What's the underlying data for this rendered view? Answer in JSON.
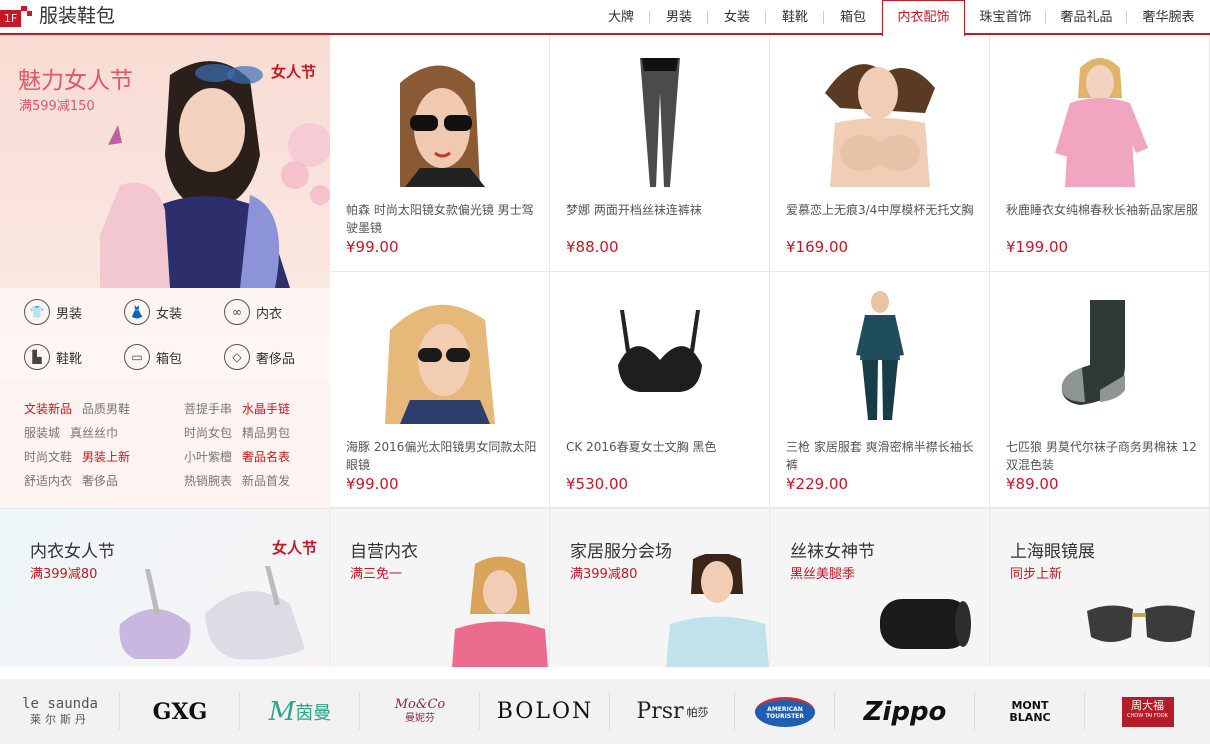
{
  "floor": {
    "number": "1F",
    "title": "服装鞋包"
  },
  "tabs": [
    "大牌",
    "男装",
    "女装",
    "鞋靴",
    "箱包",
    "内衣配饰",
    "珠宝首饰",
    "奢品礼品",
    "奢华腕表"
  ],
  "active_tab": "内衣配饰",
  "promo": {
    "title": "魅力女人节",
    "subtitle": "满599减150",
    "logo": "女人节"
  },
  "categories": [
    {
      "label": "男装",
      "icon": "shirt-icon"
    },
    {
      "label": "女装",
      "icon": "dress-icon"
    },
    {
      "label": "内衣",
      "icon": "bra-icon"
    },
    {
      "label": "鞋靴",
      "icon": "boot-icon"
    },
    {
      "label": "箱包",
      "icon": "bag-icon"
    },
    {
      "label": "奢侈品",
      "icon": "diamond-icon"
    }
  ],
  "quick_links": [
    {
      "label": "文装新品",
      "hot": true
    },
    {
      "label": "品质男鞋",
      "hot": false
    },
    {
      "label": "菩提手串",
      "hot": false
    },
    {
      "label": "水晶手链",
      "hot": true
    },
    {
      "label": "服装城",
      "hot": false
    },
    {
      "label": "真丝丝巾",
      "hot": false
    },
    {
      "label": "时尚女包",
      "hot": false
    },
    {
      "label": "精品男包",
      "hot": false
    },
    {
      "label": "时尚文鞋",
      "hot": false
    },
    {
      "label": "男装上新",
      "hot": true
    },
    {
      "label": "小叶紫檀",
      "hot": false
    },
    {
      "label": "奢品名表",
      "hot": true
    },
    {
      "label": "舒适内衣",
      "hot": false
    },
    {
      "label": "奢侈品",
      "hot": false
    },
    {
      "label": "热销腕表",
      "hot": false
    },
    {
      "label": "新品首发",
      "hot": false
    }
  ],
  "products": [
    {
      "name": "帕森 时尚太阳镜女款偏光镜 男士驾驶墨镜",
      "price": "¥99.00",
      "image": "sunglasses-woman"
    },
    {
      "name": "梦娜 两面开档丝袜连裤袜",
      "price": "¥88.00",
      "image": "pantyhose"
    },
    {
      "name": "爱慕恋上无痕3/4中厚模杯无托文胸",
      "price": "¥169.00",
      "image": "bra-model"
    },
    {
      "name": "秋鹿睡衣女纯棉春秋长袖新品家居服",
      "price": "¥199.00",
      "image": "pajamas"
    },
    {
      "name": "海豚 2016偏光太阳镜男女同款太阳眼镜",
      "price": "¥99.00",
      "image": "aviator-woman"
    },
    {
      "name": "CK 2016春夏女士文胸 黑色",
      "price": "¥530.00",
      "image": "black-bra"
    },
    {
      "name": "三枪 家居服套 爽滑密棉半襟长袖长裤",
      "price": "¥229.00",
      "image": "loungewear-man"
    },
    {
      "name": "七匹狼 男莫代尔袜子商务男棉袜 12双混色装",
      "price": "¥89.00",
      "image": "sock"
    }
  ],
  "promos": [
    {
      "title": "内衣女人节",
      "subtitle": "满399减80",
      "logo": "女人节"
    },
    {
      "title": "自营内衣",
      "subtitle": "满三免一"
    },
    {
      "title": "家居服分会场",
      "subtitle": "满399减80"
    },
    {
      "title": "丝袜女神节",
      "subtitle": "黑丝美腿季"
    },
    {
      "title": "上海眼镜展",
      "subtitle": "同步上新"
    }
  ],
  "brands": [
    "le saunda",
    "莱尔斯丹",
    "GXG",
    "茵曼",
    "Mo&Co",
    "曼妮芬",
    "BOLON",
    "Prsr",
    "帕莎",
    "AMERICAN TOURISTER",
    "Zippo",
    "MONT BLANC",
    "周大福",
    "CHOW TAI FOOK"
  ],
  "colors": {
    "accent": "#c81623",
    "promo_pink": "#e0566b"
  }
}
